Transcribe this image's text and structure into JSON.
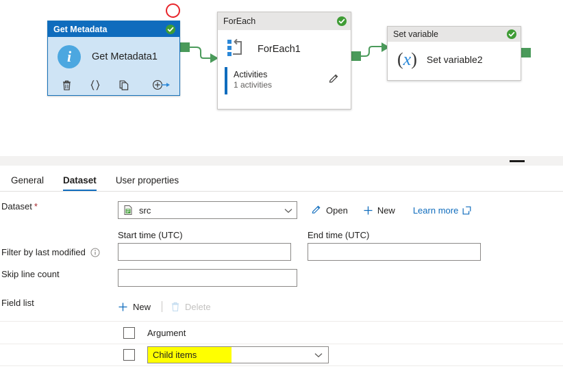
{
  "canvas": {
    "nodes": [
      {
        "type_label": "Get Metadata",
        "name": "Get Metadata1",
        "status": "success",
        "icon": "info-circle-icon",
        "tools": [
          "delete-icon",
          "code-braces-icon",
          "clone-icon",
          "add-output-icon"
        ]
      },
      {
        "type_label": "ForEach",
        "name": "ForEach1",
        "status": "success",
        "icon": "foreach-loop-icon",
        "activities_title": "Activities",
        "activities_count": "1 activities",
        "edit_icon": "pencil-icon"
      },
      {
        "type_label": "Set variable",
        "name": "Set variable2",
        "status": "success",
        "icon": "variable-x-icon"
      }
    ],
    "annotation": {
      "shape": "red-circle"
    }
  },
  "panel": {
    "tabs": [
      {
        "label": "General",
        "active": false
      },
      {
        "label": "Dataset",
        "active": true
      },
      {
        "label": "User properties",
        "active": false
      }
    ],
    "dataset": {
      "label": "Dataset",
      "required_mark": "*",
      "value": "src",
      "icon": "dataset-file-icon",
      "chevron": "chevron-down-icon",
      "actions": [
        {
          "label": "Open",
          "icon": "pencil-icon"
        },
        {
          "label": "New",
          "icon": "plus-icon"
        },
        {
          "label": "Learn more",
          "icon": "external-link-icon"
        }
      ]
    },
    "filter": {
      "label": "Filter by last modified",
      "info_icon": "info-icon",
      "start_label": "Start time (UTC)",
      "start_value": "",
      "end_label": "End time (UTC)",
      "end_value": ""
    },
    "skip": {
      "label": "Skip line count",
      "value": ""
    },
    "field_list": {
      "label": "Field list",
      "new_label": "New",
      "new_icon": "plus-icon",
      "delete_label": "Delete",
      "delete_icon": "trash-icon",
      "rows": [
        {
          "kind": "header",
          "caption": "Argument",
          "checked": false
        },
        {
          "kind": "dropdown",
          "value": "Child items",
          "highlight": "#ffff00",
          "checked": false,
          "chevron": "chevron-down-icon"
        }
      ]
    }
  },
  "colors": {
    "accent": "#0f6cbd",
    "selected_node_header": "#0f6cbd",
    "selected_node_body": "#cfe4f5",
    "success": "#3f9c35",
    "connector": "#4a9a5a",
    "annotation": "#e8242a",
    "highlight": "#ffff00",
    "required": "#a4262c"
  }
}
